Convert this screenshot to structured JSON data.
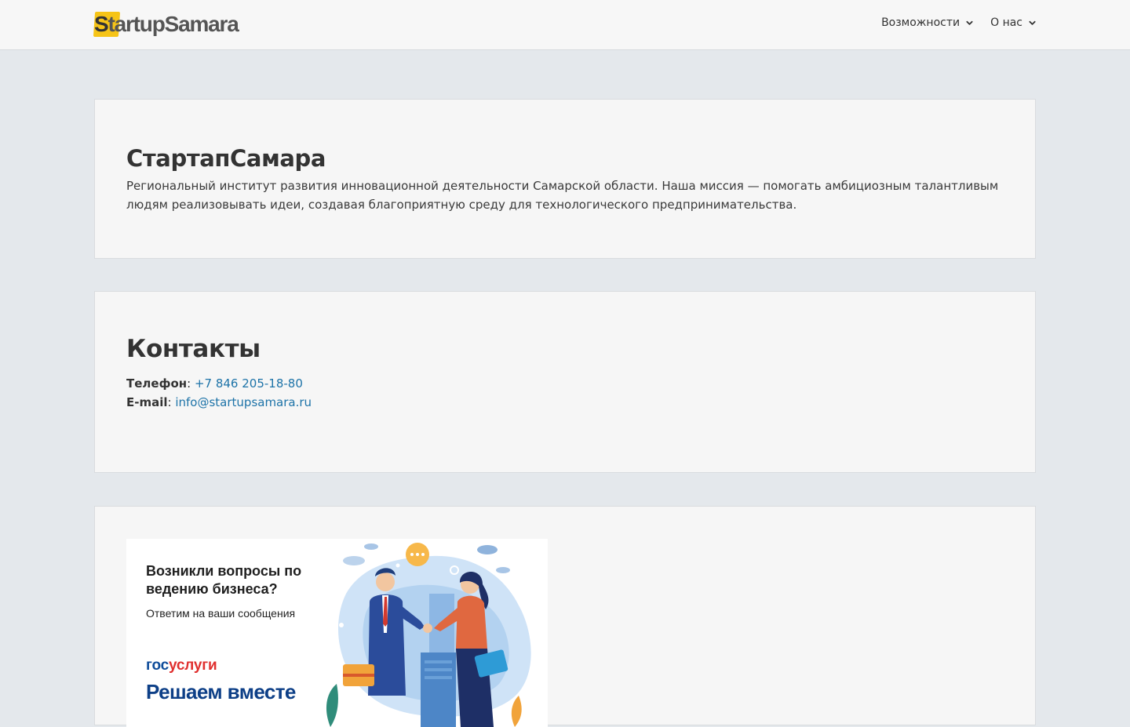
{
  "header": {
    "logo_text_first": "S",
    "logo_text_rest": "tartupSamara",
    "nav": [
      {
        "label": "Возможности",
        "icon": "chevron-down-icon"
      },
      {
        "label": "О нас",
        "icon": "chevron-down-icon"
      }
    ]
  },
  "about": {
    "title": "СтартапСамара",
    "description": "Региональный институт развития инновационной деятельности Самарской области. Наша миссия — помогать амбициозным талантливым людям реализовывать идеи, создавая благоприятную среду для технологического предпринимательства."
  },
  "contacts": {
    "title": "Контакты",
    "phone_label": "Телефон",
    "phone_value": "+7 846 205-18-80",
    "email_label": "E-mail",
    "email_value": "info@startupsamara.ru"
  },
  "banner": {
    "question": "Возникли вопросы по ведению бизнеса?",
    "subtitle": "Ответим на ваши сообщения",
    "brand_part1": "гос",
    "brand_part2": "услуги",
    "slogan": "Решаем вместе"
  },
  "colors": {
    "accent_yellow": "#f6c417",
    "link_blue": "#1d73a8",
    "page_bg": "#e4e8ec",
    "card_bg": "#f6f6f6"
  }
}
